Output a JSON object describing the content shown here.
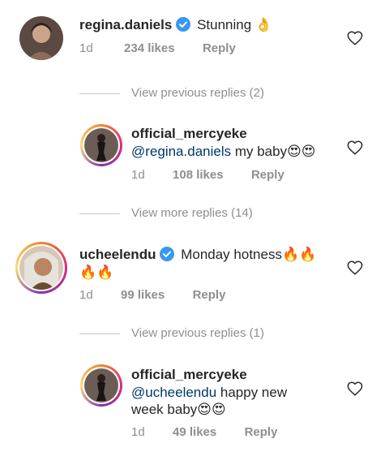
{
  "comments": [
    {
      "username": "regina.daniels",
      "verified": true,
      "text": "Stunning 👌",
      "time": "1d",
      "likes": "234 likes",
      "reply": "Reply"
    },
    {
      "username": "official_mercyeke",
      "mention": "@regina.daniels",
      "text": " my baby😍😍",
      "time": "1d",
      "likes": "108 likes",
      "reply": "Reply"
    },
    {
      "username": "ucheelendu",
      "verified": true,
      "text": "Monday hotness🔥🔥",
      "text2": "🔥🔥",
      "time": "1d",
      "likes": "99 likes",
      "reply": "Reply"
    },
    {
      "username": "official_mercyeke",
      "mention": "@ucheelendu",
      "text": " happy new",
      "text2": "week baby😍😍",
      "time": "1d",
      "likes": "49 likes",
      "reply": "Reply"
    }
  ],
  "threads": [
    {
      "label": "View previous replies (2)"
    },
    {
      "label": "View more replies (14)"
    },
    {
      "label": "View previous replies (1)"
    }
  ],
  "colors": {
    "verified": "#3897f0",
    "mention": "#00376b",
    "muted": "#8e8e8e"
  },
  "icons": {
    "like": "heart-outline-icon",
    "verified": "verified-badge-icon"
  }
}
